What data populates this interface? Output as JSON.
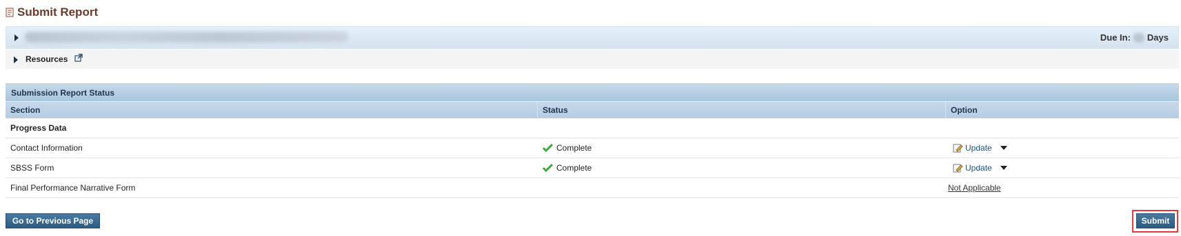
{
  "page": {
    "title": "Submit Report"
  },
  "grant_panel": {
    "due_label": "Due In:",
    "due_unit": "Days"
  },
  "resources": {
    "label": "Resources"
  },
  "status_table": {
    "title": "Submission Report Status",
    "columns": [
      "Section",
      "Status",
      "Option"
    ],
    "group": "Progress Data",
    "rows": [
      {
        "section": "Contact Information",
        "status": "Complete",
        "option": "Update"
      },
      {
        "section": "SBSS Form",
        "status": "Complete",
        "option": "Update"
      },
      {
        "section": "Final Performance Narrative Form",
        "status": "",
        "option": "Not Applicable"
      }
    ]
  },
  "buttons": {
    "previous": "Go to Previous Page",
    "submit": "Submit"
  },
  "colors": {
    "accent": "#2c5b82",
    "title": "#6b3a2a",
    "complete": "#3aa83a",
    "highlight": "#e03a3a"
  }
}
